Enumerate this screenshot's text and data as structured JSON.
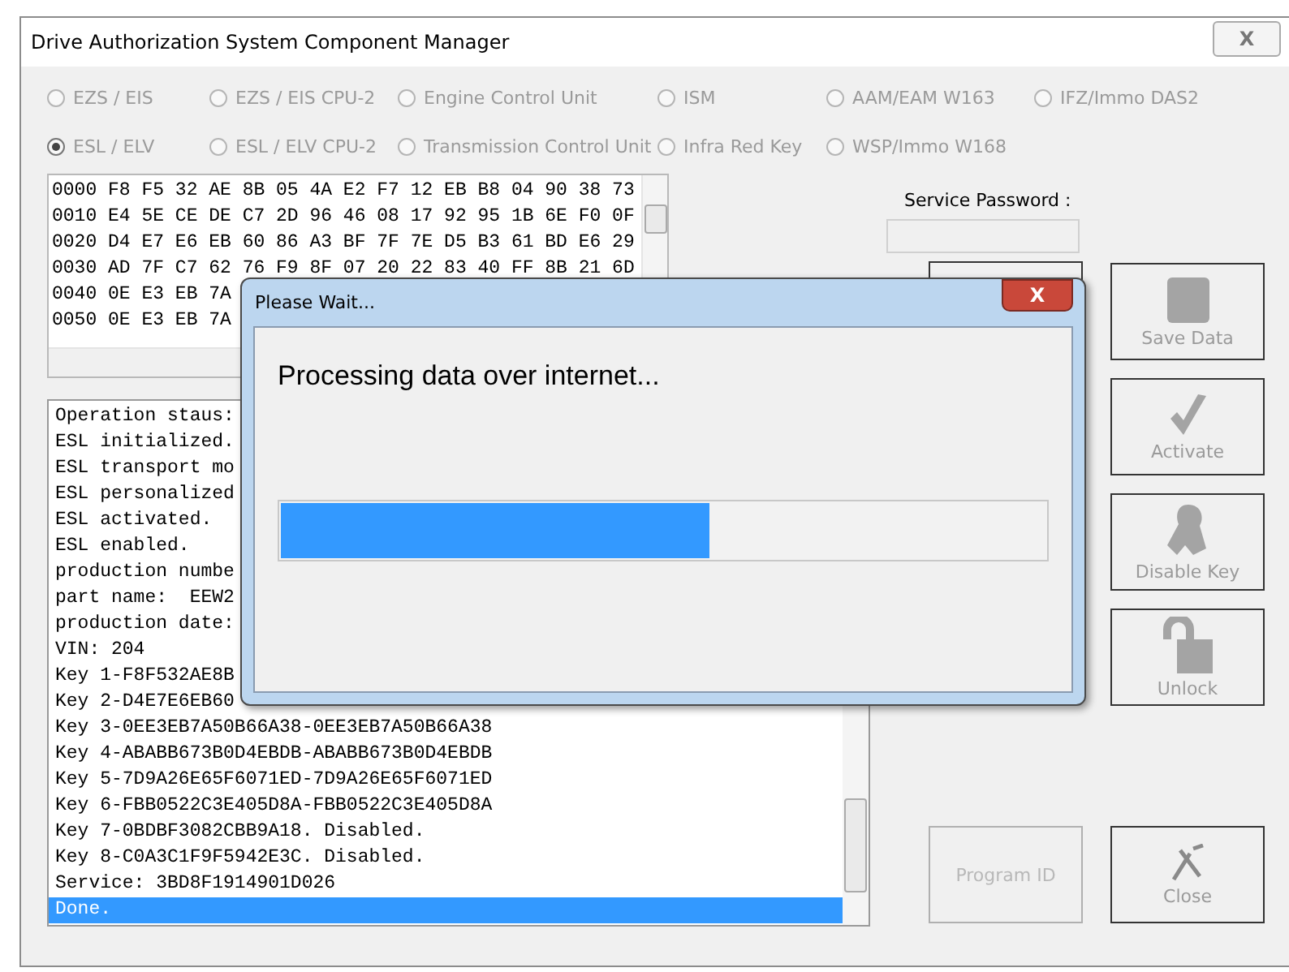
{
  "window": {
    "title": "Drive Authorization System Component Manager",
    "close_label": "X"
  },
  "radio_rows": [
    [
      {
        "label": "EZS / EIS",
        "selected": false
      },
      {
        "label": "EZS / EIS CPU-2",
        "selected": false
      },
      {
        "label": "Engine Control Unit",
        "selected": false
      },
      {
        "label": "ISM",
        "selected": false
      },
      {
        "label": "AAM/EAM W163",
        "selected": false
      },
      {
        "label": "IFZ/Immo DAS2",
        "selected": false
      }
    ],
    [
      {
        "label": "ESL / ELV",
        "selected": true
      },
      {
        "label": "ESL / ELV CPU-2",
        "selected": false
      },
      {
        "label": "Transmission Control Unit",
        "selected": false
      },
      {
        "label": "Infra Red Key",
        "selected": false
      },
      {
        "label": "WSP/Immo W168",
        "selected": false
      }
    ]
  ],
  "hex_dump": [
    "0000 F8 F5 32 AE 8B 05 4A E2 F7 12 EB B8 04 90 38 73",
    "0010 E4 5E CE DE C7 2D 96 46 08 17 92 95 1B 6E F0 0F",
    "0020 D4 E7 E6 EB 60 86 A3 BF 7F 7E D5 B3 61 BD E6 29",
    "0030 AD 7F C7 62 76 F9 8F 07 20 22 83 40 FF 8B 21 6D",
    "0040 0E E3 EB 7A",
    "0050 0E E3 EB 7A"
  ],
  "service_password": {
    "label": "Service Password :"
  },
  "log": [
    {
      "text": "Operation staus:",
      "selected": false
    },
    {
      "text": "ESL initialized.",
      "selected": false
    },
    {
      "text": "ESL transport mo",
      "selected": false
    },
    {
      "text": "ESL personalized",
      "selected": false
    },
    {
      "text": "ESL activated.",
      "selected": false
    },
    {
      "text": "ESL enabled.",
      "selected": false
    },
    {
      "text": "production numbe",
      "selected": false
    },
    {
      "text": "part name:  EEW2",
      "selected": false
    },
    {
      "text": "production date:",
      "selected": false
    },
    {
      "text": "VIN: 204",
      "selected": false
    },
    {
      "text": "Key 1-F8F532AE8B",
      "selected": false
    },
    {
      "text": "Key 2-D4E7E6EB60",
      "selected": false
    },
    {
      "text": "Key 3-0EE3EB7A50B66A38-0EE3EB7A50B66A38",
      "selected": false
    },
    {
      "text": "Key 4-ABABB673B0D4EBDB-ABABB673B0D4EBDB",
      "selected": false
    },
    {
      "text": "Key 5-7D9A26E65F6071ED-7D9A26E65F6071ED",
      "selected": false
    },
    {
      "text": "Key 6-FBB0522C3E405D8A-FBB0522C3E405D8A",
      "selected": false
    },
    {
      "text": "Key 7-0BDBF3082CBB9A18. Disabled.",
      "selected": false
    },
    {
      "text": "Key 8-C0A3C1F9F5942E3C. Disabled.",
      "selected": false
    },
    {
      "text": "Service: 3BD8F1914901D026",
      "selected": false
    },
    {
      "text": "Done.",
      "selected": true
    }
  ],
  "left_buttons": [
    {
      "disabled": false
    },
    {
      "label": "Program ID",
      "disabled": true
    }
  ],
  "right_buttons": [
    {
      "label": "Save Data",
      "disabled": false
    },
    {
      "label": "Activate",
      "disabled": false
    },
    {
      "label": "Disable Key",
      "disabled": false
    },
    {
      "label": "Unlock",
      "disabled": false
    },
    {
      "label": "Close",
      "disabled": false
    }
  ],
  "dialog": {
    "title": "Please Wait...",
    "close_label": "X",
    "message": "Processing data over internet...",
    "level": 0.56
  }
}
